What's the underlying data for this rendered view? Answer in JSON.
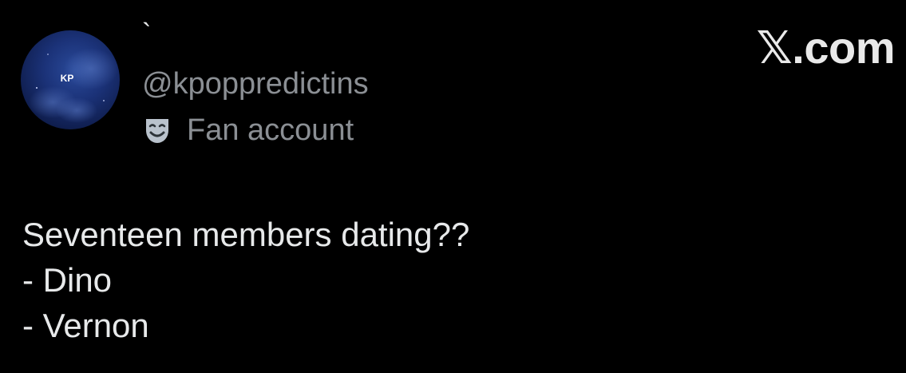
{
  "author": {
    "display_name": "`",
    "handle": "@kpoppredictins",
    "avatar_text": "KP",
    "badge_icon": "theater-mask-icon",
    "badge_label": "Fan account"
  },
  "brand": {
    "label": "𝕏.com"
  },
  "post": {
    "lines": [
      "Seventeen members dating??",
      "- Dino",
      "- Vernon"
    ]
  },
  "colors": {
    "background": "#000000",
    "primary_text": "#e7e9ea",
    "secondary_text": "#8b8f94",
    "avatar_bg": "#142a6b"
  }
}
